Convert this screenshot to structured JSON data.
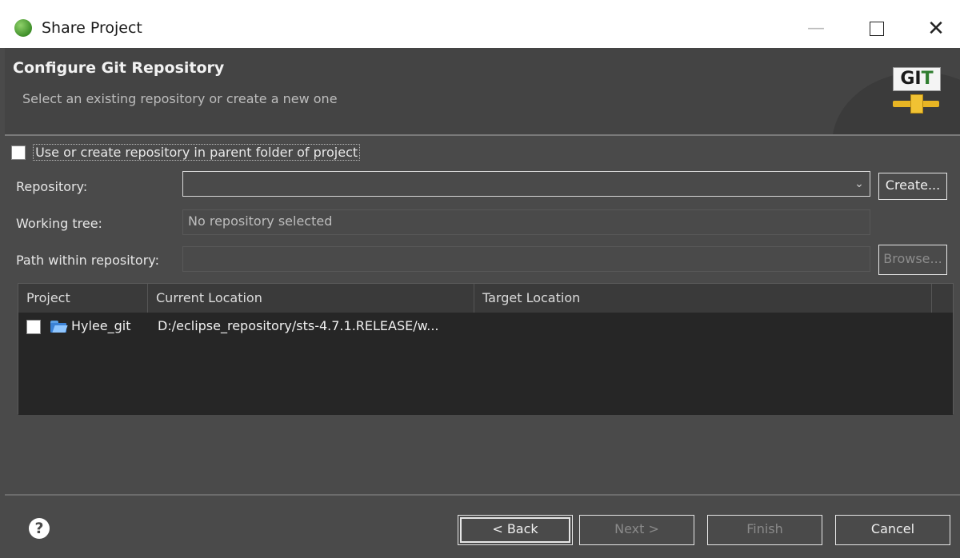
{
  "window": {
    "title": "Share Project",
    "controls": {
      "minimize": "—",
      "maximize": "☐",
      "close": "✕"
    }
  },
  "banner": {
    "heading": "Configure Git Repository",
    "subtitle": "Select an existing repository or create a new one",
    "logo_text_left": "GI",
    "logo_text_right": "T"
  },
  "options": {
    "parent_folder_checkbox_label": "Use or create repository in parent folder of project",
    "parent_folder_checked": false
  },
  "form": {
    "repository_label": "Repository:",
    "repository_value": "",
    "create_button": "Create...",
    "working_tree_label": "Working tree:",
    "working_tree_value": "No repository selected",
    "path_label": "Path within repository:",
    "path_value": "",
    "browse_button": "Browse..."
  },
  "table": {
    "columns": [
      "Project",
      "Current Location",
      "Target Location"
    ],
    "rows": [
      {
        "project": "Hylee_git",
        "current_location": "D:/eclipse_repository/sts-4.7.1.RELEASE/w...",
        "target_location": "",
        "checked": false
      }
    ]
  },
  "footer": {
    "help": "?",
    "back": "< Back",
    "next": "Next >",
    "finish": "Finish",
    "cancel": "Cancel"
  }
}
